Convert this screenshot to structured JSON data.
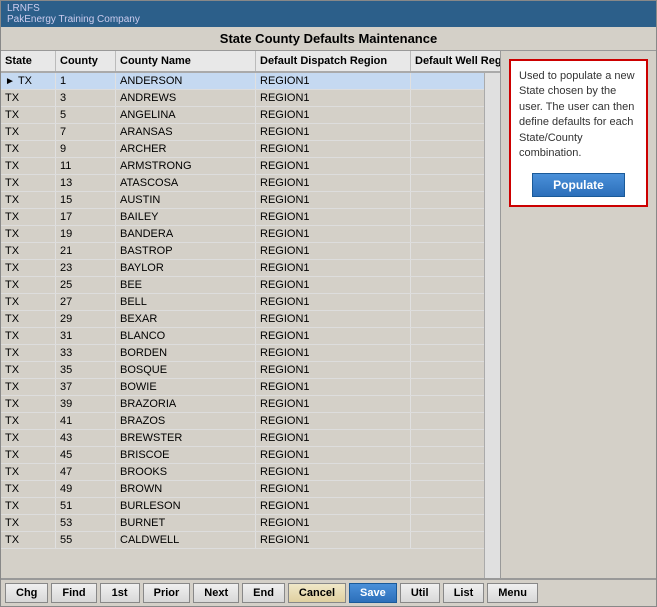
{
  "app": {
    "id": "LRNFS",
    "company": "PakEnergy Training Company",
    "title": "State County Defaults Maintenance"
  },
  "table": {
    "columns": [
      "State",
      "County",
      "County Name",
      "Default Dispatch Region",
      "Default Well Region"
    ],
    "rows": [
      {
        "state": "TX",
        "county": "1",
        "county_name": "ANDERSON",
        "dispatch_region": "REGION1",
        "well_region": "",
        "selected": true
      },
      {
        "state": "TX",
        "county": "3",
        "county_name": "ANDREWS",
        "dispatch_region": "REGION1",
        "well_region": ""
      },
      {
        "state": "TX",
        "county": "5",
        "county_name": "ANGELINA",
        "dispatch_region": "REGION1",
        "well_region": ""
      },
      {
        "state": "TX",
        "county": "7",
        "county_name": "ARANSAS",
        "dispatch_region": "REGION1",
        "well_region": ""
      },
      {
        "state": "TX",
        "county": "9",
        "county_name": "ARCHER",
        "dispatch_region": "REGION1",
        "well_region": ""
      },
      {
        "state": "TX",
        "county": "11",
        "county_name": "ARMSTRONG",
        "dispatch_region": "REGION1",
        "well_region": ""
      },
      {
        "state": "TX",
        "county": "13",
        "county_name": "ATASCOSA",
        "dispatch_region": "REGION1",
        "well_region": ""
      },
      {
        "state": "TX",
        "county": "15",
        "county_name": "AUSTIN",
        "dispatch_region": "REGION1",
        "well_region": ""
      },
      {
        "state": "TX",
        "county": "17",
        "county_name": "BAILEY",
        "dispatch_region": "REGION1",
        "well_region": ""
      },
      {
        "state": "TX",
        "county": "19",
        "county_name": "BANDERA",
        "dispatch_region": "REGION1",
        "well_region": ""
      },
      {
        "state": "TX",
        "county": "21",
        "county_name": "BASTROP",
        "dispatch_region": "REGION1",
        "well_region": ""
      },
      {
        "state": "TX",
        "county": "23",
        "county_name": "BAYLOR",
        "dispatch_region": "REGION1",
        "well_region": ""
      },
      {
        "state": "TX",
        "county": "25",
        "county_name": "BEE",
        "dispatch_region": "REGION1",
        "well_region": ""
      },
      {
        "state": "TX",
        "county": "27",
        "county_name": "BELL",
        "dispatch_region": "REGION1",
        "well_region": ""
      },
      {
        "state": "TX",
        "county": "29",
        "county_name": "BEXAR",
        "dispatch_region": "REGION1",
        "well_region": ""
      },
      {
        "state": "TX",
        "county": "31",
        "county_name": "BLANCO",
        "dispatch_region": "REGION1",
        "well_region": ""
      },
      {
        "state": "TX",
        "county": "33",
        "county_name": "BORDEN",
        "dispatch_region": "REGION1",
        "well_region": ""
      },
      {
        "state": "TX",
        "county": "35",
        "county_name": "BOSQUE",
        "dispatch_region": "REGION1",
        "well_region": ""
      },
      {
        "state": "TX",
        "county": "37",
        "county_name": "BOWIE",
        "dispatch_region": "REGION1",
        "well_region": ""
      },
      {
        "state": "TX",
        "county": "39",
        "county_name": "BRAZORIA",
        "dispatch_region": "REGION1",
        "well_region": ""
      },
      {
        "state": "TX",
        "county": "41",
        "county_name": "BRAZOS",
        "dispatch_region": "REGION1",
        "well_region": ""
      },
      {
        "state": "TX",
        "county": "43",
        "county_name": "BREWSTER",
        "dispatch_region": "REGION1",
        "well_region": ""
      },
      {
        "state": "TX",
        "county": "45",
        "county_name": "BRISCOE",
        "dispatch_region": "REGION1",
        "well_region": ""
      },
      {
        "state": "TX",
        "county": "47",
        "county_name": "BROOKS",
        "dispatch_region": "REGION1",
        "well_region": ""
      },
      {
        "state": "TX",
        "county": "49",
        "county_name": "BROWN",
        "dispatch_region": "REGION1",
        "well_region": ""
      },
      {
        "state": "TX",
        "county": "51",
        "county_name": "BURLESON",
        "dispatch_region": "REGION1",
        "well_region": ""
      },
      {
        "state": "TX",
        "county": "53",
        "county_name": "BURNET",
        "dispatch_region": "REGION1",
        "well_region": ""
      },
      {
        "state": "TX",
        "county": "55",
        "county_name": "CALDWELL",
        "dispatch_region": "REGION1",
        "well_region": ""
      }
    ]
  },
  "side_panel": {
    "info_text": "Used to populate a new State chosen by the user. The user can then define defaults for each State/County combination.",
    "populate_label": "Populate"
  },
  "toolbar": {
    "buttons": [
      {
        "label": "Chg",
        "name": "chg-button"
      },
      {
        "label": "Find",
        "name": "find-button"
      },
      {
        "label": "1st",
        "name": "first-button"
      },
      {
        "label": "Prior",
        "name": "prior-button"
      },
      {
        "label": "Next",
        "name": "next-button"
      },
      {
        "label": "End",
        "name": "end-button"
      },
      {
        "label": "Cancel",
        "name": "cancel-button",
        "type": "cancel"
      },
      {
        "label": "Save",
        "name": "save-button",
        "type": "save"
      },
      {
        "label": "Util",
        "name": "util-button"
      },
      {
        "label": "List",
        "name": "list-button"
      },
      {
        "label": "Menu",
        "name": "menu-button"
      }
    ]
  }
}
